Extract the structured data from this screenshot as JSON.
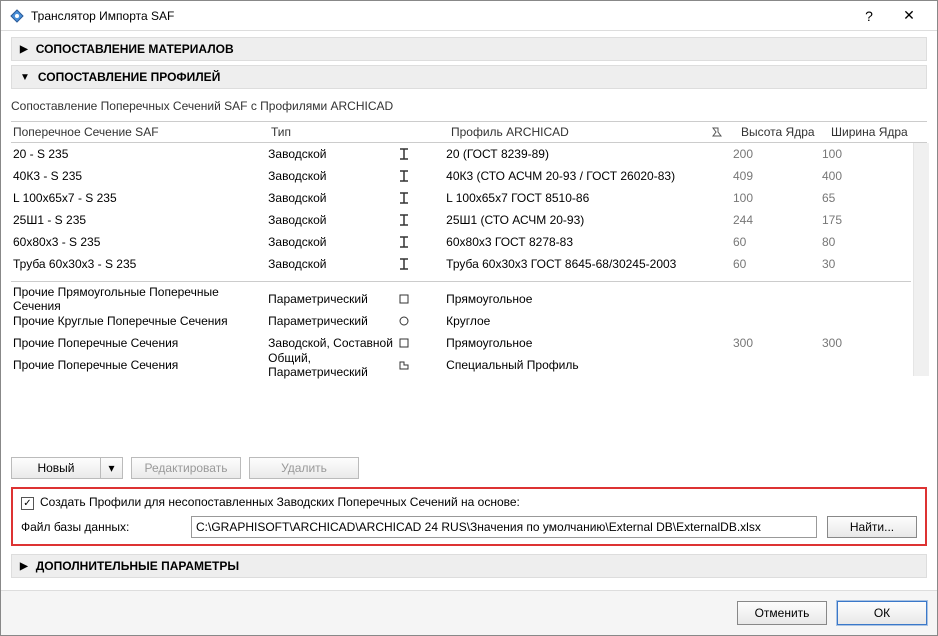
{
  "window": {
    "title": "Транслятор Импорта SAF"
  },
  "sections": {
    "materials": "СОПОСТАВЛЕНИЕ МАТЕРИАЛОВ",
    "profiles": "СОПОСТАВЛЕНИЕ ПРОФИЛЕЙ",
    "extra": "ДОПОЛНИТЕЛЬНЫЕ ПАРАМЕТРЫ"
  },
  "profiles_desc": "Сопоставление Поперечных Сечений SAF с Профилями ARCHICAD",
  "columns": {
    "saf": "Поперечное Сечение SAF",
    "type": "Тип",
    "profile": "Профиль ARCHICAD",
    "height": "Высота Ядра",
    "width": "Ширина Ядра"
  },
  "rows": [
    {
      "saf": "20 - S 235",
      "type": "Заводской",
      "shape": "I",
      "profile": "20 (ГОСТ 8239-89)",
      "h": "200",
      "w": "100"
    },
    {
      "saf": "40К3 - S 235",
      "type": "Заводской",
      "shape": "I",
      "profile": "40К3 (СТО АСЧМ 20-93 / ГОСТ 26020-83)",
      "h": "409",
      "w": "400"
    },
    {
      "saf": "L 100x65x7 - S 235",
      "type": "Заводской",
      "shape": "I",
      "profile": "L 100x65x7 ГОСТ 8510-86",
      "h": "100",
      "w": "65"
    },
    {
      "saf": "25Ш1 - S 235",
      "type": "Заводской",
      "shape": "I",
      "profile": "25Ш1 (СТО АСЧМ 20-93)",
      "h": "244",
      "w": "175"
    },
    {
      "saf": "60x80x3 - S 235",
      "type": "Заводской",
      "shape": "I",
      "profile": "60x80x3 ГОСТ 8278-83",
      "h": "60",
      "w": "80"
    },
    {
      "saf": "Труба 60х30х3 - S 235",
      "type": "Заводской",
      "shape": "I",
      "profile": "Труба 60х30х3 ГОСТ 8645-68/30245-2003",
      "h": "60",
      "w": "30"
    }
  ],
  "genericRows": [
    {
      "saf": "Прочие Прямоугольные Поперечные Сечения",
      "type": "Параметрический",
      "shape": "rect",
      "profile": "Прямоугольное",
      "h": "",
      "w": ""
    },
    {
      "saf": "Прочие Круглые Поперечные Сечения",
      "type": "Параметрический",
      "shape": "circle",
      "profile": "Круглое",
      "h": "",
      "w": ""
    },
    {
      "saf": "Прочие Поперечные Сечения",
      "type": "Заводской, Составной",
      "shape": "rect",
      "profile": "Прямоугольное",
      "h": "300",
      "w": "300"
    },
    {
      "saf": "Прочие Поперечные Сечения",
      "type": "Общий, Параметрический",
      "shape": "custom",
      "profile": "Специальный Профиль",
      "h": "",
      "w": ""
    }
  ],
  "buttons": {
    "new": "Новый",
    "edit": "Редактировать",
    "delete": "Удалить",
    "browse": "Найти...",
    "cancel": "Отменить",
    "ok": "ОК"
  },
  "checkbox_label": "Создать Профили для несопоставленных Заводских Поперечных Сечений на основе:",
  "db_label": "Файл базы данных:",
  "db_path": "C:\\GRAPHISOFT\\ARCHICAD\\ARCHICAD 24 RUS\\Значения по умолчанию\\External DB\\ExternalDB.xlsx"
}
